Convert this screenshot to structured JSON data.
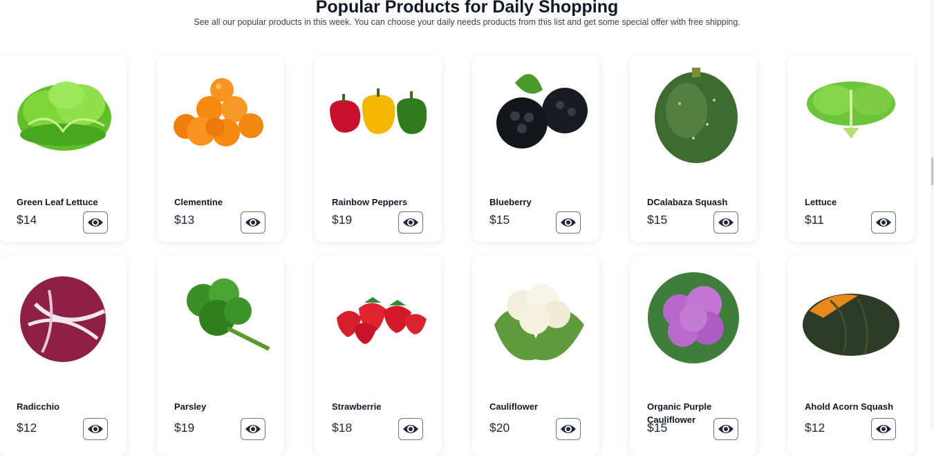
{
  "header": {
    "title": "Popular Products for Daily Shopping",
    "subtitle": "See all our popular products in this week. You can choose your daily needs products from this list and get some special offer with free shipping."
  },
  "products": [
    {
      "name": "Green Leaf Lettuce",
      "price": "$14",
      "image": "green-leaf-lettuce-image"
    },
    {
      "name": "Clementine",
      "price": "$13",
      "image": "clementine-image"
    },
    {
      "name": "Rainbow Peppers",
      "price": "$19",
      "image": "rainbow-peppers-image"
    },
    {
      "name": "Blueberry",
      "price": "$15",
      "image": "blueberry-image"
    },
    {
      "name": "DCalabaza Squash",
      "price": "$15",
      "image": "squash-image"
    },
    {
      "name": "Lettuce",
      "price": "$11",
      "image": "lettuce-image"
    },
    {
      "name": "Radicchio",
      "price": "$12",
      "image": "radicchio-image"
    },
    {
      "name": "Parsley",
      "price": "$19",
      "image": "parsley-image"
    },
    {
      "name": "Strawberrie",
      "price": "$18",
      "image": "strawberry-image"
    },
    {
      "name": "Cauliflower",
      "price": "$20",
      "image": "cauliflower-image"
    },
    {
      "name": "Organic Purple Cauliflower",
      "price": "$15",
      "image": "purple-cauliflower-image"
    },
    {
      "name": "Ahold Acorn Squash",
      "price": "$12",
      "image": "acorn-squash-image"
    }
  ],
  "icons": {
    "view": "eye-icon"
  },
  "colors": {
    "text": "#111827",
    "icon": "#1f2937"
  }
}
